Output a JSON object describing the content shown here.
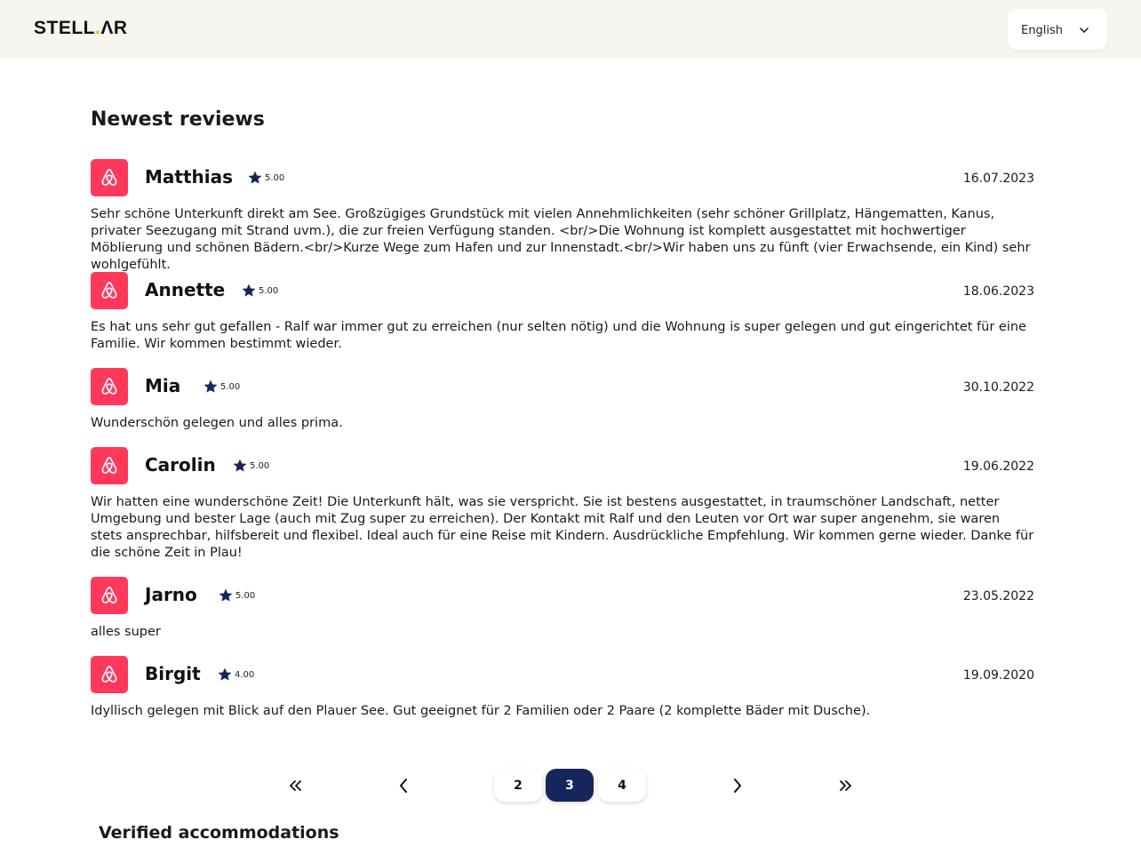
{
  "header": {
    "logo_left": "STELL",
    "logo_dot": ".",
    "logo_right": "ΛR",
    "language": "English"
  },
  "section_title": "Newest reviews",
  "reviews": [
    {
      "name": "Matthias",
      "rating": "5.00",
      "date": "16.07.2023",
      "text": "Sehr schöne Unterkunft direkt am See. Großzügiges Grundstück mit vielen Annehmlichkeiten (sehr schöner Grillplatz, Hängematten, Kanus, privater Seezugang mit Strand uvm.), die zur freien Verfügung standen. <br/>Die Wohnung ist komplett ausgestattet mit hochwertiger Möblierung und schönen Bädern.<br/>Kurze Wege zum Hafen und zur Innenstadt.<br/>Wir haben uns zu fünft (vier Erwachsende, ein Kind) sehr wohlgefühlt."
    },
    {
      "name": "Annette",
      "rating": "5.00",
      "date": "18.06.2023",
      "text": "Es hat uns sehr gut gefallen - Ralf war immer gut zu erreichen (nur selten nötig) und die Wohnung is super gelegen und gut eingerichtet für eine Familie. Wir kommen bestimmt wieder."
    },
    {
      "name": "Mia",
      "rating": "5.00",
      "date": "30.10.2022",
      "text": "Wunderschön gelegen und alles prima."
    },
    {
      "name": "Carolin",
      "rating": "5.00",
      "date": "19.06.2022",
      "text": "Wir hatten eine wunderschöne Zeit! Die Unterkunft hält, was sie verspricht. Sie ist bestens ausgestattet, in traumschöner Landschaft, netter Umgebung und bester Lage (auch mit Zug super zu erreichen). Der Kontakt mit Ralf und den Leuten vor Ort war super angenehm, sie waren stets ansprechbar, hilfsbereit und flexibel. Ideal auch für eine Reise mit Kindern. Ausdrückliche Empfehlung. Wir kommen gerne wieder. Danke für die schöne Zeit in Plau!"
    },
    {
      "name": "Jarno",
      "rating": "5.00",
      "date": "23.05.2022",
      "text": "alles super"
    },
    {
      "name": "Birgit",
      "rating": "4.00",
      "date": "19.09.2020",
      "text": "Idyllisch gelegen mit Blick auf den Plauer See. Gut geeignet für 2 Familien oder 2 Paare (2 komplette Bäder mit Dusche)."
    }
  ],
  "pagination": {
    "pages": [
      "2",
      "3",
      "4"
    ],
    "current": "3"
  },
  "verified_title": "Verified accommodations",
  "colors": {
    "header_bg": "#f7f5ef",
    "airbnb_red": "#ff385c",
    "star_navy": "#15265c",
    "active_page": "#15265c"
  }
}
